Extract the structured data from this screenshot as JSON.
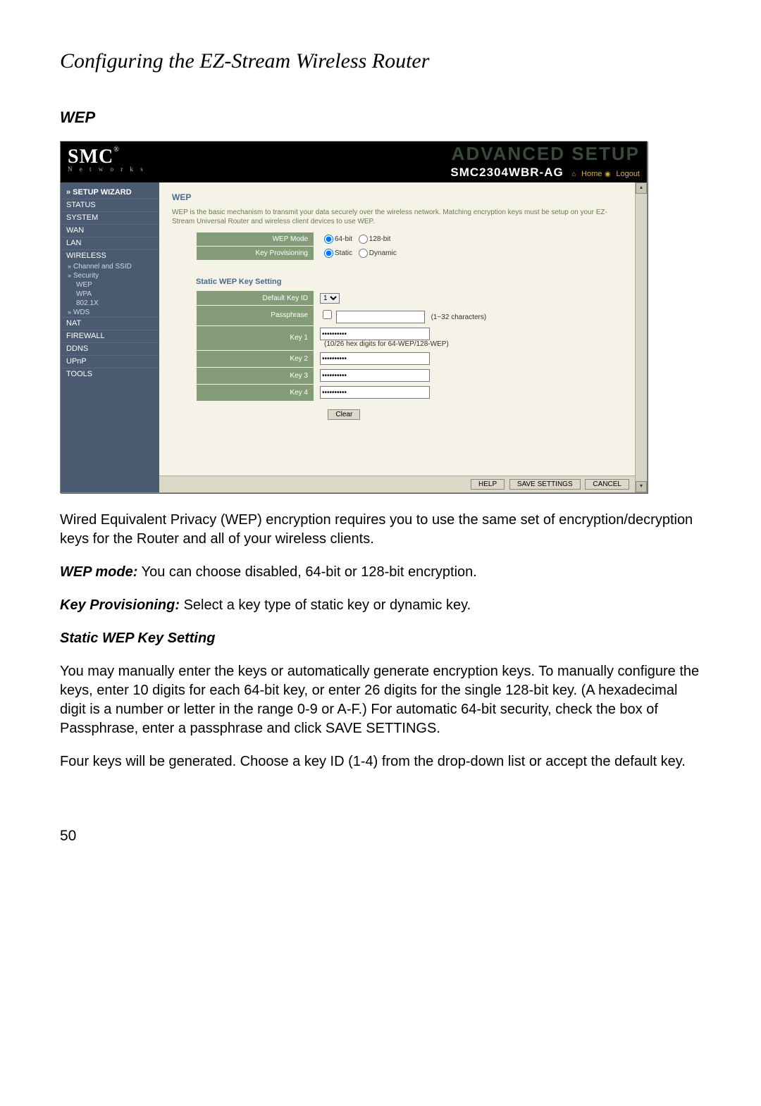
{
  "page_title": "Configuring the EZ-Stream Wireless Router",
  "section": "WEP",
  "page_number": "50",
  "shot": {
    "logo_brand": "SMC",
    "logo_sub": "N e t w o r k s",
    "adv_setup": "ADVANCED SETUP",
    "model": "SMC2304WBR-AG",
    "home": "Home",
    "logout": "Logout",
    "sidebar": {
      "setup_wizard": "» SETUP WIZARD",
      "status": "STATUS",
      "system": "SYSTEM",
      "wan": "WAN",
      "lan": "LAN",
      "wireless": "WIRELESS",
      "channel": "Channel and SSID",
      "security": "Security",
      "wep": "WEP",
      "wpa": "WPA",
      "dot1x": "802.1X",
      "wds": "WDS",
      "nat": "NAT",
      "firewall": "FIREWALL",
      "ddns": "DDNS",
      "upnp": "UPnP",
      "tools": "TOOLS"
    },
    "content": {
      "title": "WEP",
      "desc": "WEP is the basic mechanism to transmit your data securely over the wireless network. Matching encryption keys must be setup on your EZ-Stream Universal Router and wireless client devices to use WEP.",
      "wep_mode_label": "WEP Mode",
      "wep_mode_64": "64-bit",
      "wep_mode_128": "128-bit",
      "key_prov_label": "Key Provisioning",
      "key_prov_static": "Static",
      "key_prov_dynamic": "Dynamic",
      "static_heading": "Static WEP Key Setting",
      "default_key_label": "Default Key ID",
      "default_key_value": "1",
      "passphrase_label": "Passphrase",
      "passphrase_hint": "(1~32 characters)",
      "key1_label": "Key 1",
      "key1_hint": "(10/26 hex digits for 64-WEP/128-WEP)",
      "key2_label": "Key 2",
      "key3_label": "Key 3",
      "key4_label": "Key 4",
      "masked": "**********",
      "clear": "Clear",
      "help": "HELP",
      "save": "SAVE SETTINGS",
      "cancel": "CANCEL"
    }
  },
  "body": {
    "p1": "Wired Equivalent Privacy (WEP) encryption requires you to use the same set of encryption/decryption keys for the Router and all of your wireless clients.",
    "p2a": "WEP mode:",
    "p2b": " You can choose disabled, 64-bit or 128-bit encryption.",
    "p3a": "Key Provisioning:",
    "p3b": " Select a key type of static key or dynamic key.",
    "subheading": "Static WEP Key Setting",
    "p4": "You may manually enter the keys or automatically generate encryption keys. To manually configure the keys, enter 10 digits for each 64-bit key, or enter 26 digits for the single 128-bit key. (A hexadecimal digit is a number or letter in the range 0-9 or A-F.) For automatic 64-bit security, check the box of Passphrase, enter a passphrase and click SAVE SETTINGS.",
    "p5": "Four keys will be generated. Choose a key ID (1-4) from the drop-down list or accept the default key."
  }
}
